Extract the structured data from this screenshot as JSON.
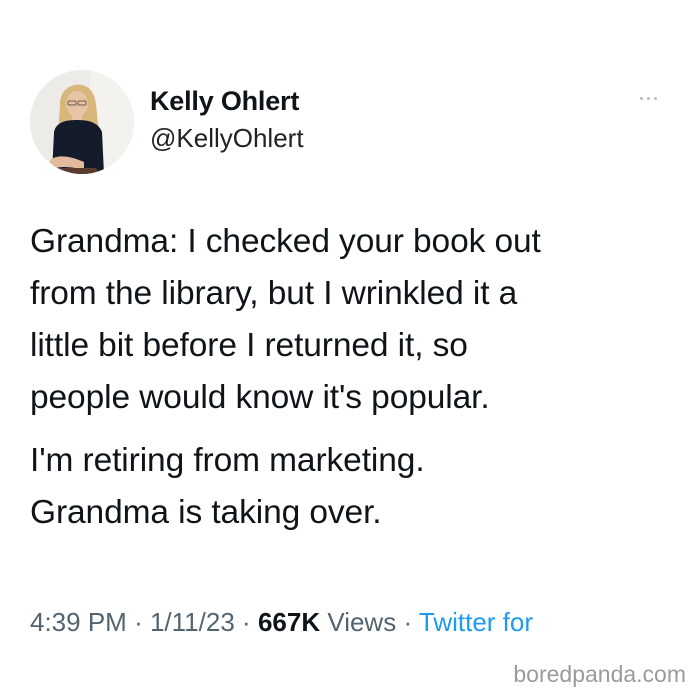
{
  "user": {
    "display_name": "Kelly Ohlert",
    "handle": "@KellyOhlert",
    "avatar_icon": "profile-photo"
  },
  "tweet": {
    "paragraphs": [
      "Grandma: I checked your book out\nfrom the library, but I wrinkled it a\nlittle bit before I returned it, so\npeople would know it's popular.",
      "I'm retiring from marketing.\nGrandma is taking over."
    ]
  },
  "meta": {
    "time": "4:39 PM",
    "separator": "·",
    "date": "1/11/23",
    "views_count": "667K",
    "views_label": "Views",
    "source": "Twitter for"
  },
  "menu": {
    "icon": "more-options-icon"
  },
  "watermark": "boredpanda.com",
  "colors": {
    "text": "#0f1419",
    "secondary": "#536471",
    "link": "#1d9bf0",
    "background": "#ffffff"
  }
}
